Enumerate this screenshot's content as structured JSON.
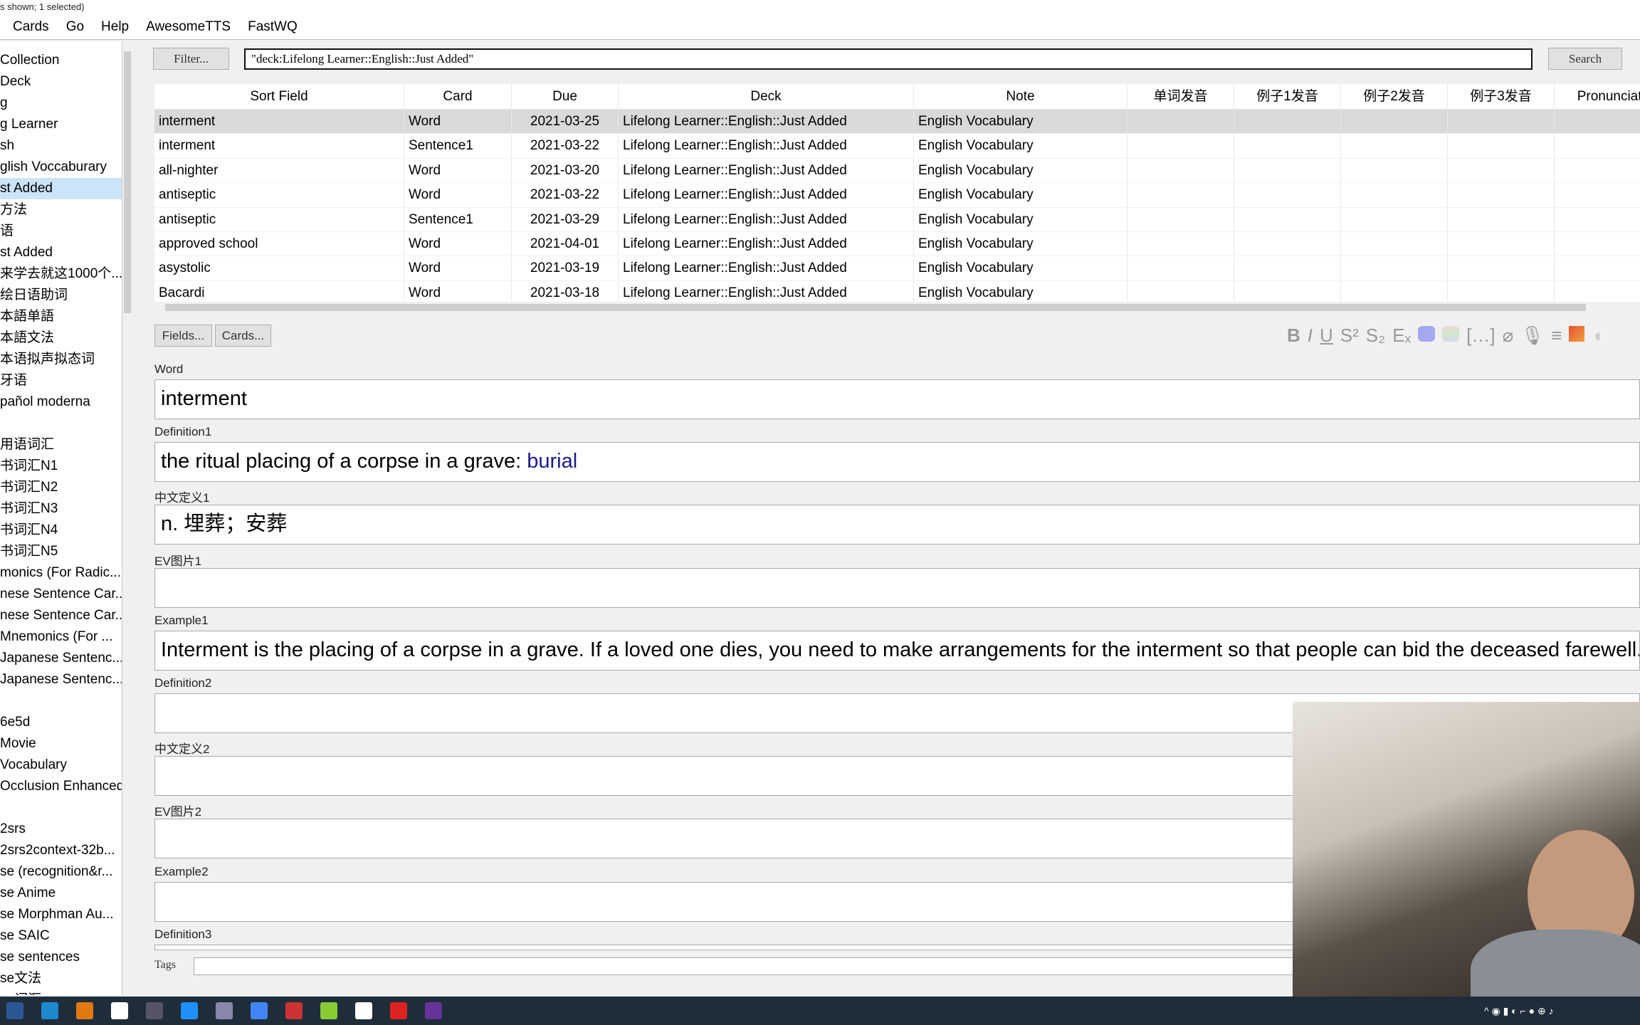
{
  "status_text": "s shown; 1 selected)",
  "menu": [
    "Cards",
    "Go",
    "Help",
    "AwesomeTTS",
    "FastWQ"
  ],
  "sidebar": {
    "items": [
      "Collection",
      " Deck",
      "g",
      "g Learner",
      "sh",
      "glish Voccaburary",
      "st Added",
      "方法",
      "语",
      "st Added",
      "来学去就这1000个...",
      "绘日语助词",
      "本語单語",
      "本語文法",
      "本语拟声拟态词",
      "牙语",
      "pañol moderna",
      "",
      "用语词汇",
      "书词汇N1",
      "书词汇N2",
      "书词汇N3",
      "书词汇N4",
      "书词汇N5",
      "monics (For Radic...",
      "nese Sentence Car...",
      "nese Sentence Car...",
      "Mnemonics (For ...",
      "Japanese Sentenc...",
      "Japanese Sentenc...",
      "",
      "6e5d",
      " Movie",
      " Vocabulary",
      "Occlusion Enhanced",
      "",
      "2srs",
      "2srs2context-32b...",
      "se (recognition&r...",
      "se Anime",
      "se Morphman Au...",
      "se SAIC",
      "se sentences",
      "se文法",
      "se词汇"
    ],
    "selected_index": 6
  },
  "filter_button": "Filter...",
  "search_query": "\"deck:Lifelong Learner::English::Just Added\"",
  "search_button": "Search",
  "table": {
    "columns": [
      "Sort Field",
      "Card",
      "Due",
      "Deck",
      "Note",
      "单词发音",
      "例子1发音",
      "例子2发音",
      "例子3发音",
      "Pronunciatio"
    ],
    "rows": [
      [
        "interment",
        "Word",
        "2021-03-25",
        "Lifelong Learner::English::Just Added",
        "English Vocabulary"
      ],
      [
        "interment",
        "Sentence1",
        "2021-03-22",
        "Lifelong Learner::English::Just Added",
        "English Vocabulary"
      ],
      [
        "all-nighter",
        "Word",
        "2021-03-20",
        "Lifelong Learner::English::Just Added",
        "English Vocabulary"
      ],
      [
        "antiseptic",
        "Word",
        "2021-03-22",
        "Lifelong Learner::English::Just Added",
        "English Vocabulary"
      ],
      [
        "antiseptic",
        "Sentence1",
        "2021-03-29",
        "Lifelong Learner::English::Just Added",
        "English Vocabulary"
      ],
      [
        "approved school",
        "Word",
        "2021-04-01",
        "Lifelong Learner::English::Just Added",
        "English Vocabulary"
      ],
      [
        "asystolic",
        "Word",
        "2021-03-19",
        "Lifelong Learner::English::Just Added",
        "English Vocabulary"
      ],
      [
        "Bacardi",
        "Word",
        "2021-03-18",
        "Lifelong Learner::English::Just Added",
        "English Vocabulary"
      ]
    ],
    "selected_row": 0
  },
  "editor": {
    "fields_button": "Fields...",
    "cards_button": "Cards...",
    "toolbar_icons": [
      "bold-icon",
      "italic-icon",
      "underline-icon",
      "superscript-icon",
      "subscript-icon",
      "clear-format-icon",
      "text-color-icon",
      "highlight-color-icon",
      "cloze-icon",
      "attach-icon",
      "record-icon",
      "more-icon",
      "image-occlusion-icon",
      "misc-icon"
    ],
    "fields": [
      {
        "label": "Word",
        "value": "interment"
      },
      {
        "label": "Definition1",
        "value": "the ritual placing of a corpse in a grave: ",
        "link": "burial"
      },
      {
        "label": "中文定义1",
        "value": "n. 埋葬；安葬"
      },
      {
        "label": "EV图片1",
        "value": ""
      },
      {
        "label": "Example1",
        "value": "Interment is the placing of a corpse in a grave. If a loved one dies, you need to make arrangements for the interment so that people can bid the deceased farewell."
      },
      {
        "label": "Definition2",
        "value": ""
      },
      {
        "label": "中文定义2",
        "value": ""
      },
      {
        "label": "EV图片2",
        "value": ""
      },
      {
        "label": "Example2",
        "value": ""
      },
      {
        "label": "Definition3",
        "value": ""
      }
    ],
    "tags_label": "Tags",
    "tags_value": ""
  },
  "colors": {
    "selection": "#cce4f7",
    "link": "#1a1a8c",
    "taskbar": "#1f2d3a"
  },
  "taskbar_icons": [
    "word-icon",
    "dictionary-icon",
    "search-app-icon",
    "media-player-icon",
    "anki-icon",
    "app-s-icon",
    "app-icon",
    "chrome-icon",
    "app-red-icon",
    "app-green-icon",
    "app-s-circle-icon",
    "record-icon",
    "obs-icon"
  ]
}
